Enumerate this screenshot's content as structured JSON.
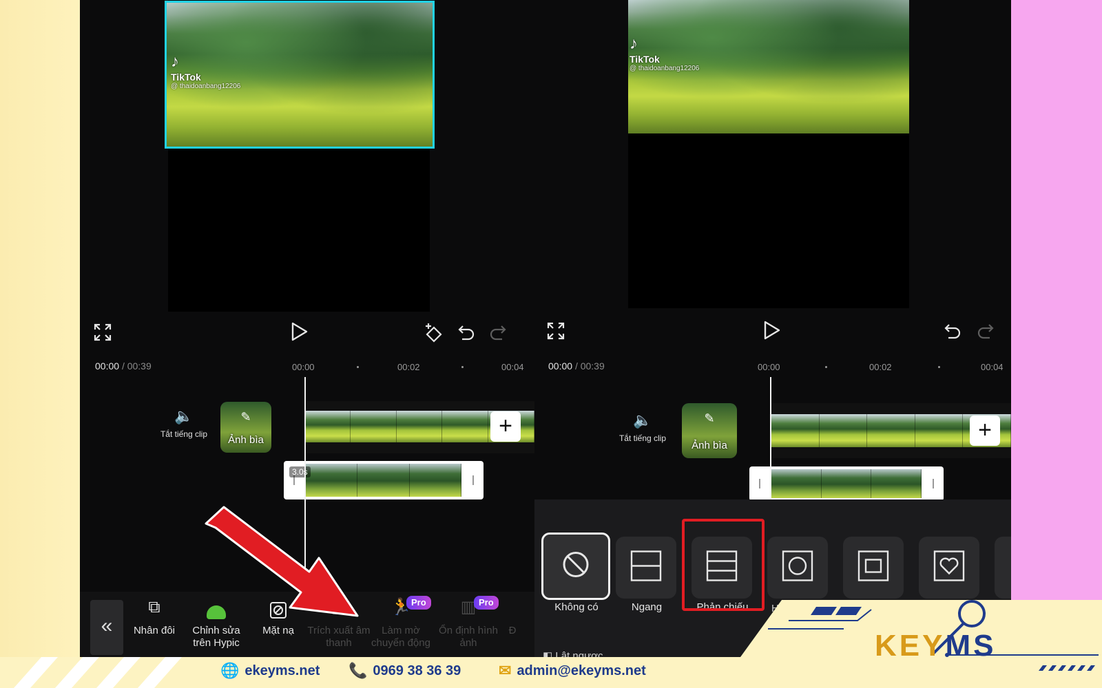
{
  "left_editor": {
    "video_watermark": {
      "brand": "TikTok",
      "handle": "@ thaidoanbang12206"
    },
    "time_current": "00:00",
    "time_separator": "/",
    "time_total": "00:39",
    "ruler": [
      "00:00",
      "00:02",
      "00:04"
    ],
    "mute_label": "Tắt tiếng clip",
    "cover_label": "Ảnh bìa",
    "subclip_duration": "3.0s",
    "toolbar": {
      "tools": [
        {
          "label": "Nhân đôi",
          "icon": "duplicate-icon",
          "enabled": true
        },
        {
          "label": "Chỉnh sửa trên Hypic",
          "icon": "hypic-icon",
          "enabled": true
        },
        {
          "label": "Mặt nạ",
          "icon": "mask-icon",
          "enabled": true
        },
        {
          "label": "Trích xuất âm thanh",
          "icon": "extract-audio-icon",
          "enabled": false
        },
        {
          "label": "Làm mờ chuyển động",
          "icon": "motion-blur-icon",
          "enabled": false,
          "badge": "Pro"
        },
        {
          "label": "Ổn định hình ảnh",
          "icon": "stabilize-icon",
          "enabled": false,
          "badge": "Pro"
        },
        {
          "label": "Đ",
          "icon": "",
          "enabled": false
        }
      ]
    }
  },
  "right_editor": {
    "video_watermark": {
      "brand": "TikTok",
      "handle": "@ thaidoanbang12206"
    },
    "time_current": "00:00",
    "time_separator": "/",
    "time_total": "00:39",
    "ruler": [
      "00:00",
      "00:02",
      "00:04"
    ],
    "mute_label": "Tắt tiếng clip",
    "cover_label": "Ảnh bìa",
    "masks": [
      {
        "label": "Không có",
        "icon": "none-icon",
        "selected": true
      },
      {
        "label": "Ngang",
        "icon": "horizontal-icon",
        "selected": false
      },
      {
        "label": "Phản chiếu",
        "icon": "mirror-icon",
        "selected": false,
        "highlighted": true
      },
      {
        "label": "H",
        "icon": "circle-icon",
        "selected": false
      },
      {
        "label": "",
        "icon": "rectangle-icon",
        "selected": false
      },
      {
        "label": "",
        "icon": "heart-icon",
        "selected": false
      }
    ],
    "bottom_partial": "Lật ngược"
  },
  "footer": {
    "website": "ekeyms.net",
    "phone": "0969 38 36 39",
    "email": "admin@ekeyms.net",
    "logo_text_1": "KEY",
    "logo_text_2": "MS"
  },
  "colors": {
    "selection_cyan": "#22d3e6",
    "highlight_red": "#e11d23",
    "brand_blue": "#1f3b8c",
    "brand_gold": "#d89a1a",
    "background_pink": "#f7a7ef",
    "background_yellow": "#fdf1b4"
  }
}
